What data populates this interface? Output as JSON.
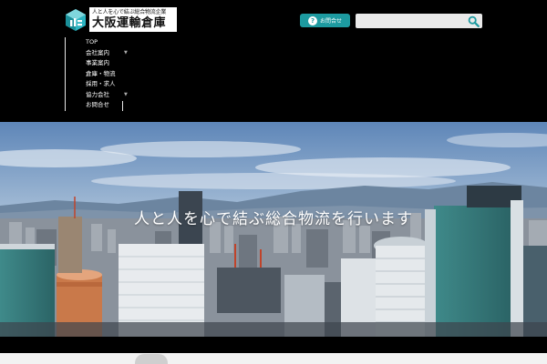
{
  "header": {
    "logo": {
      "tagline": "人と人を心で結ぶ総合物流企業",
      "name": "大阪運輸倉庫"
    },
    "contact_button": {
      "icon": "question-icon",
      "icon_glyph": "?",
      "label": "お問合せ"
    },
    "search": {
      "value": "",
      "placeholder": "",
      "icon": "search-icon"
    }
  },
  "nav": {
    "items": [
      {
        "label": "TOP",
        "has_submenu": false
      },
      {
        "label": "会社案内",
        "has_submenu": true
      },
      {
        "label": "事業案内",
        "has_submenu": false
      },
      {
        "label": "倉庫・物流",
        "has_submenu": false
      },
      {
        "label": "採用・求人",
        "has_submenu": false
      },
      {
        "label": "協力会社",
        "has_submenu": true
      },
      {
        "label": "お問合せ",
        "has_submenu": false
      }
    ],
    "submenu_arrow": "▼"
  },
  "hero": {
    "title": "人と人を心で結ぶ総合物流を行います"
  },
  "colors": {
    "accent": "#1d9aa0",
    "background": "#000000"
  }
}
